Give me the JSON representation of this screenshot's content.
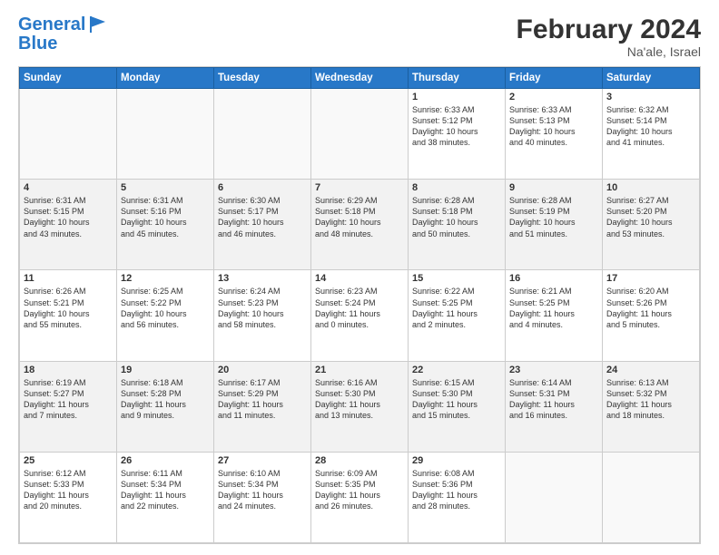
{
  "header": {
    "logo_line1": "General",
    "logo_line2": "Blue",
    "month_year": "February 2024",
    "location": "Na'ale, Israel"
  },
  "weekdays": [
    "Sunday",
    "Monday",
    "Tuesday",
    "Wednesday",
    "Thursday",
    "Friday",
    "Saturday"
  ],
  "weeks": [
    [
      {
        "day": "",
        "info": ""
      },
      {
        "day": "",
        "info": ""
      },
      {
        "day": "",
        "info": ""
      },
      {
        "day": "",
        "info": ""
      },
      {
        "day": "1",
        "info": "Sunrise: 6:33 AM\nSunset: 5:12 PM\nDaylight: 10 hours\nand 38 minutes."
      },
      {
        "day": "2",
        "info": "Sunrise: 6:33 AM\nSunset: 5:13 PM\nDaylight: 10 hours\nand 40 minutes."
      },
      {
        "day": "3",
        "info": "Sunrise: 6:32 AM\nSunset: 5:14 PM\nDaylight: 10 hours\nand 41 minutes."
      }
    ],
    [
      {
        "day": "4",
        "info": "Sunrise: 6:31 AM\nSunset: 5:15 PM\nDaylight: 10 hours\nand 43 minutes."
      },
      {
        "day": "5",
        "info": "Sunrise: 6:31 AM\nSunset: 5:16 PM\nDaylight: 10 hours\nand 45 minutes."
      },
      {
        "day": "6",
        "info": "Sunrise: 6:30 AM\nSunset: 5:17 PM\nDaylight: 10 hours\nand 46 minutes."
      },
      {
        "day": "7",
        "info": "Sunrise: 6:29 AM\nSunset: 5:18 PM\nDaylight: 10 hours\nand 48 minutes."
      },
      {
        "day": "8",
        "info": "Sunrise: 6:28 AM\nSunset: 5:18 PM\nDaylight: 10 hours\nand 50 minutes."
      },
      {
        "day": "9",
        "info": "Sunrise: 6:28 AM\nSunset: 5:19 PM\nDaylight: 10 hours\nand 51 minutes."
      },
      {
        "day": "10",
        "info": "Sunrise: 6:27 AM\nSunset: 5:20 PM\nDaylight: 10 hours\nand 53 minutes."
      }
    ],
    [
      {
        "day": "11",
        "info": "Sunrise: 6:26 AM\nSunset: 5:21 PM\nDaylight: 10 hours\nand 55 minutes."
      },
      {
        "day": "12",
        "info": "Sunrise: 6:25 AM\nSunset: 5:22 PM\nDaylight: 10 hours\nand 56 minutes."
      },
      {
        "day": "13",
        "info": "Sunrise: 6:24 AM\nSunset: 5:23 PM\nDaylight: 10 hours\nand 58 minutes."
      },
      {
        "day": "14",
        "info": "Sunrise: 6:23 AM\nSunset: 5:24 PM\nDaylight: 11 hours\nand 0 minutes."
      },
      {
        "day": "15",
        "info": "Sunrise: 6:22 AM\nSunset: 5:25 PM\nDaylight: 11 hours\nand 2 minutes."
      },
      {
        "day": "16",
        "info": "Sunrise: 6:21 AM\nSunset: 5:25 PM\nDaylight: 11 hours\nand 4 minutes."
      },
      {
        "day": "17",
        "info": "Sunrise: 6:20 AM\nSunset: 5:26 PM\nDaylight: 11 hours\nand 5 minutes."
      }
    ],
    [
      {
        "day": "18",
        "info": "Sunrise: 6:19 AM\nSunset: 5:27 PM\nDaylight: 11 hours\nand 7 minutes."
      },
      {
        "day": "19",
        "info": "Sunrise: 6:18 AM\nSunset: 5:28 PM\nDaylight: 11 hours\nand 9 minutes."
      },
      {
        "day": "20",
        "info": "Sunrise: 6:17 AM\nSunset: 5:29 PM\nDaylight: 11 hours\nand 11 minutes."
      },
      {
        "day": "21",
        "info": "Sunrise: 6:16 AM\nSunset: 5:30 PM\nDaylight: 11 hours\nand 13 minutes."
      },
      {
        "day": "22",
        "info": "Sunrise: 6:15 AM\nSunset: 5:30 PM\nDaylight: 11 hours\nand 15 minutes."
      },
      {
        "day": "23",
        "info": "Sunrise: 6:14 AM\nSunset: 5:31 PM\nDaylight: 11 hours\nand 16 minutes."
      },
      {
        "day": "24",
        "info": "Sunrise: 6:13 AM\nSunset: 5:32 PM\nDaylight: 11 hours\nand 18 minutes."
      }
    ],
    [
      {
        "day": "25",
        "info": "Sunrise: 6:12 AM\nSunset: 5:33 PM\nDaylight: 11 hours\nand 20 minutes."
      },
      {
        "day": "26",
        "info": "Sunrise: 6:11 AM\nSunset: 5:34 PM\nDaylight: 11 hours\nand 22 minutes."
      },
      {
        "day": "27",
        "info": "Sunrise: 6:10 AM\nSunset: 5:34 PM\nDaylight: 11 hours\nand 24 minutes."
      },
      {
        "day": "28",
        "info": "Sunrise: 6:09 AM\nSunset: 5:35 PM\nDaylight: 11 hours\nand 26 minutes."
      },
      {
        "day": "29",
        "info": "Sunrise: 6:08 AM\nSunset: 5:36 PM\nDaylight: 11 hours\nand 28 minutes."
      },
      {
        "day": "",
        "info": ""
      },
      {
        "day": "",
        "info": ""
      }
    ]
  ]
}
